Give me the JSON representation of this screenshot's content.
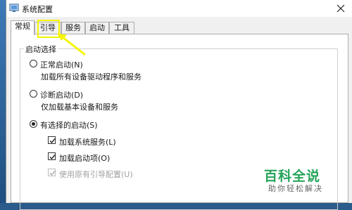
{
  "window": {
    "title": "系统配置"
  },
  "tabs": [
    {
      "label": "常规"
    },
    {
      "label": "引导"
    },
    {
      "label": "服务"
    },
    {
      "label": "启动"
    },
    {
      "label": "工具"
    }
  ],
  "startup_group": {
    "label": "启动选择",
    "options": [
      {
        "label": "正常启动(N)",
        "description": "加载所有设备驱动程序和服务",
        "selected": false
      },
      {
        "label": "诊断启动(D)",
        "description": "仅加载基本设备和服务",
        "selected": false
      },
      {
        "label": "有选择的启动(S)",
        "selected": true
      }
    ],
    "checkboxes": [
      {
        "label": "加载系统服务(L)",
        "checked": true,
        "enabled": true
      },
      {
        "label": "加载启动项(O)",
        "checked": true,
        "enabled": true
      },
      {
        "label": "使用原有引导配置(U)",
        "checked": true,
        "enabled": false
      }
    ]
  },
  "watermark": {
    "logo": "百科全说",
    "tagline": "助你轻松解决"
  },
  "colors": {
    "highlight": "#f5f500",
    "arrow": "#f5f500",
    "watermark": "#25a45a"
  }
}
